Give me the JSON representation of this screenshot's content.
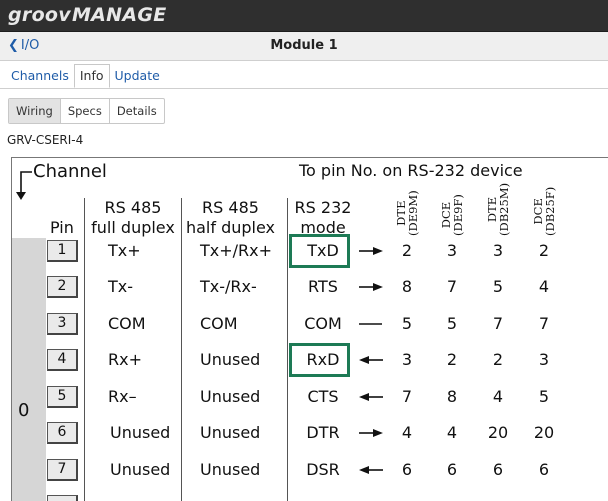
{
  "app": {
    "brand_part1": "groov",
    "brand_part2": "MANAGE"
  },
  "titlebar": {
    "back_label": "I/O",
    "title": "Module 1"
  },
  "tabs": [
    {
      "label": "Channels",
      "active": false
    },
    {
      "label": "Info",
      "active": true
    },
    {
      "label": "Update",
      "active": false
    }
  ],
  "subtabs": [
    {
      "label": "Wiring",
      "active": true
    },
    {
      "label": "Specs",
      "active": false
    },
    {
      "label": "Details",
      "active": false
    }
  ],
  "model": "GRV-CSERI-4",
  "diagram": {
    "channel_label": "Channel",
    "topin_label": "To pin No. on RS-232 device",
    "headers": {
      "pin": "Pin",
      "rs485full_1": "RS 485",
      "rs485full_2": "full duplex",
      "rs485half_1": "RS 485",
      "rs485half_2": "half duplex",
      "rs232_1": "RS 232",
      "rs232_2": "mode",
      "dte9_1": "DTE",
      "dte9_2": "(DE9M)",
      "dce9_1": "DCE",
      "dce9_2": "(DE9F)",
      "dte25_1": "DTE",
      "dte25_2": "(DB25M)",
      "dce25_1": "DCE",
      "dce25_2": "(DB25F)"
    },
    "channel_number": "0",
    "highlight_color": "#1d7a55",
    "rows": [
      {
        "pin": "1",
        "full": "Tx+",
        "half": "Tx+/Rx+",
        "rs232": "TxD",
        "dir": "right",
        "dte9": "2",
        "dce9": "3",
        "dte25": "3",
        "dce25": "2"
      },
      {
        "pin": "2",
        "full": "Tx-",
        "half": "Tx-/Rx-",
        "rs232": "RTS",
        "dir": "right",
        "dte9": "8",
        "dce9": "7",
        "dte25": "5",
        "dce25": "4"
      },
      {
        "pin": "3",
        "full": "COM",
        "half": "COM",
        "rs232": "COM",
        "dir": "none",
        "dte9": "5",
        "dce9": "5",
        "dte25": "7",
        "dce25": "7"
      },
      {
        "pin": "4",
        "full": "Rx+",
        "half": "Unused",
        "rs232": "RxD",
        "dir": "left",
        "dte9": "3",
        "dce9": "2",
        "dte25": "2",
        "dce25": "3"
      },
      {
        "pin": "5",
        "full": "Rx–",
        "half": "Unused",
        "rs232": "CTS",
        "dir": "left",
        "dte9": "7",
        "dce9": "8",
        "dte25": "4",
        "dce25": "5"
      },
      {
        "pin": "6",
        "full": "Unused",
        "half": "Unused",
        "rs232": "DTR",
        "dir": "right",
        "dte9": "4",
        "dce9": "4",
        "dte25": "20",
        "dce25": "20"
      },
      {
        "pin": "7",
        "full": "Unused",
        "half": "Unused",
        "rs232": "DSR",
        "dir": "left",
        "dte9": "6",
        "dce9": "6",
        "dte25": "6",
        "dce25": "6"
      }
    ]
  }
}
